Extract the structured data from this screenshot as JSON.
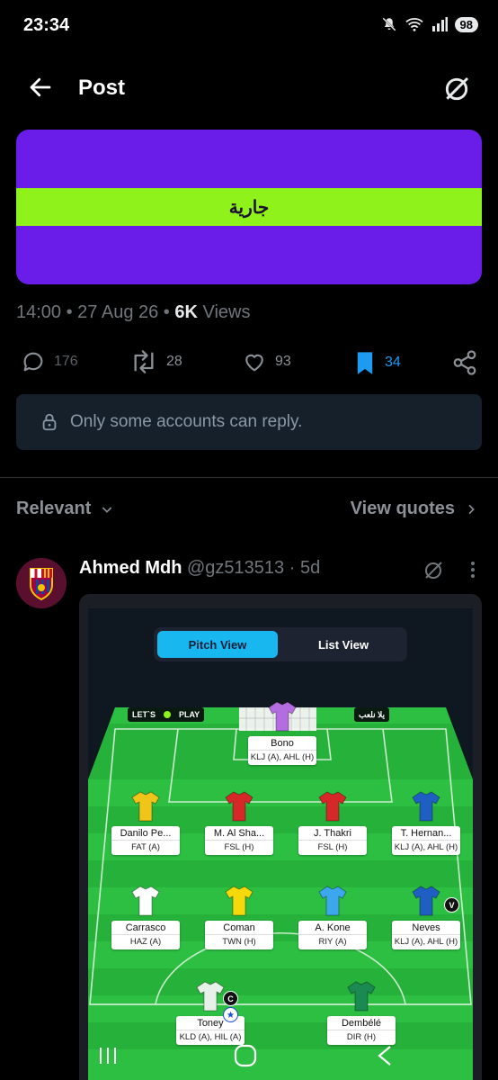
{
  "status_bar": {
    "time": "23:34",
    "battery": "98"
  },
  "header": {
    "title": "Post"
  },
  "banner": {
    "text": "جارية"
  },
  "post_meta": {
    "time_date": "14:00 • 27 Aug 26 • ",
    "views_count": "6K",
    "views_label": " Views"
  },
  "actions": {
    "replies": "176",
    "reposts": "28",
    "likes": "93",
    "bookmarks": "34"
  },
  "colors": {
    "accent": "#1d9bf0",
    "banner_purple": "#6a1de8",
    "banner_green": "#8ff21a",
    "pitch_green": "#27b43c"
  },
  "reply_restriction": {
    "text": "Only some accounts can reply."
  },
  "sort": {
    "label": "Relevant",
    "quotes_label": "View quotes"
  },
  "reply": {
    "name": "Ahmed Mdh",
    "handle": "@gz513513",
    "age": "· 5d"
  },
  "fantasy": {
    "tabs": {
      "active": "Pitch View",
      "other": "List View"
    },
    "sponsor_left": "LET`S",
    "sponsor_left_b": "PLAY",
    "sponsor_right": "يلا نلعب",
    "players": [
      {
        "name": "Bono",
        "fixture": "KLJ (A), AHL (H)",
        "kit": "#b46de0"
      },
      {
        "name": "Danilo Pe...",
        "fixture": "FAT (A)",
        "kit": "#f0c419"
      },
      {
        "name": "M. Al Sha...",
        "fixture": "FSL (H)",
        "kit": "#d62828"
      },
      {
        "name": "J. Thakri",
        "fixture": "FSL (H)",
        "kit": "#d62828"
      },
      {
        "name": "T. Hernan...",
        "fixture": "KLJ (A), AHL (H)",
        "kit": "#1f5fc4"
      },
      {
        "name": "Carrasco",
        "fixture": "HAZ (A)",
        "kit": "#ffffff"
      },
      {
        "name": "Coman",
        "fixture": "TWN (H)",
        "kit": "#f5d90a"
      },
      {
        "name": "A. Kone",
        "fixture": "RIY (A)",
        "kit": "#3da7ee"
      },
      {
        "name": "Neves",
        "fixture": "KLJ (A), AHL (H)",
        "kit": "#1f5fc4"
      },
      {
        "name": "Toney",
        "fixture": "KLD (A), HIL (A)",
        "kit": "#e8f0ea"
      },
      {
        "name": "Dembélé",
        "fixture": "DIR (H)",
        "kit": "#1a8a52"
      }
    ],
    "badges": {
      "vice": "V",
      "captain": "C"
    }
  }
}
